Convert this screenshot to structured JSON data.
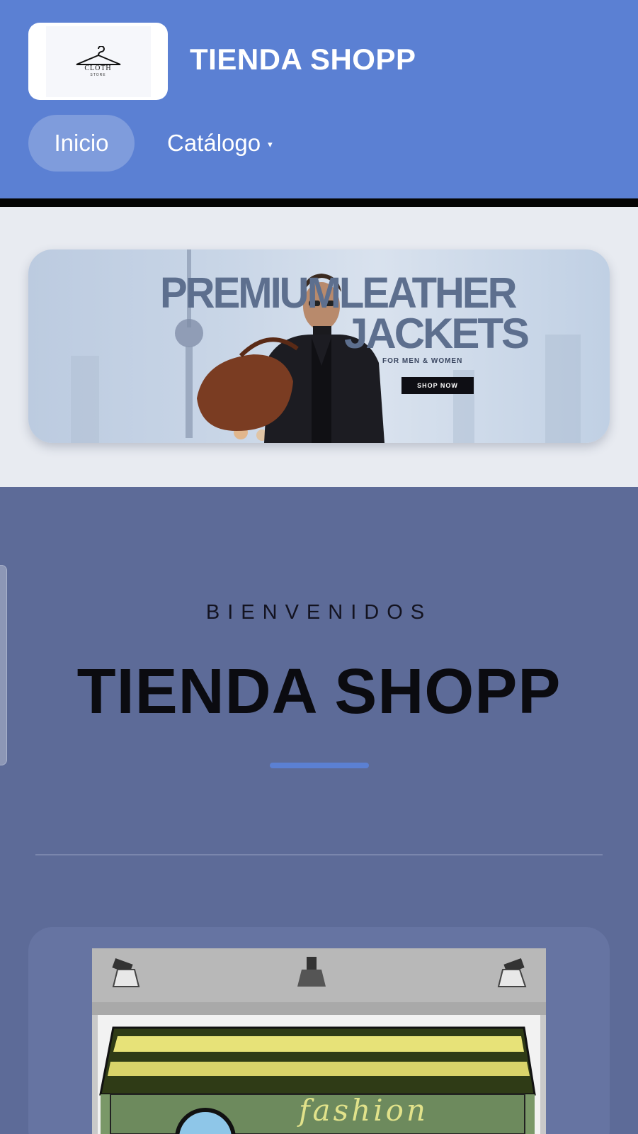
{
  "header": {
    "logo": {
      "word": "CLOTH",
      "sub": "STORE",
      "icon": "hanger-icon"
    },
    "title": "TIENDA SHOPP",
    "nav": {
      "inicio": "Inicio",
      "catalogo": "Catálogo",
      "caret": "▾"
    }
  },
  "banner": {
    "line1_left": "PREMIUM",
    "line1_right": "LEATHER",
    "line2": "JACKETS",
    "subline": "FOR MEN & WOMEN",
    "cta": "SHOP NOW"
  },
  "welcome": {
    "kicker": "BIENVENIDOS",
    "title": "TIENDA SHOPP"
  },
  "store_sign": "fashion",
  "colors": {
    "header_bg": "#5b80d3",
    "banner_section_bg": "#e8ebf1",
    "welcome_bg": "#5d6b98",
    "accent": "#5b80d3"
  }
}
